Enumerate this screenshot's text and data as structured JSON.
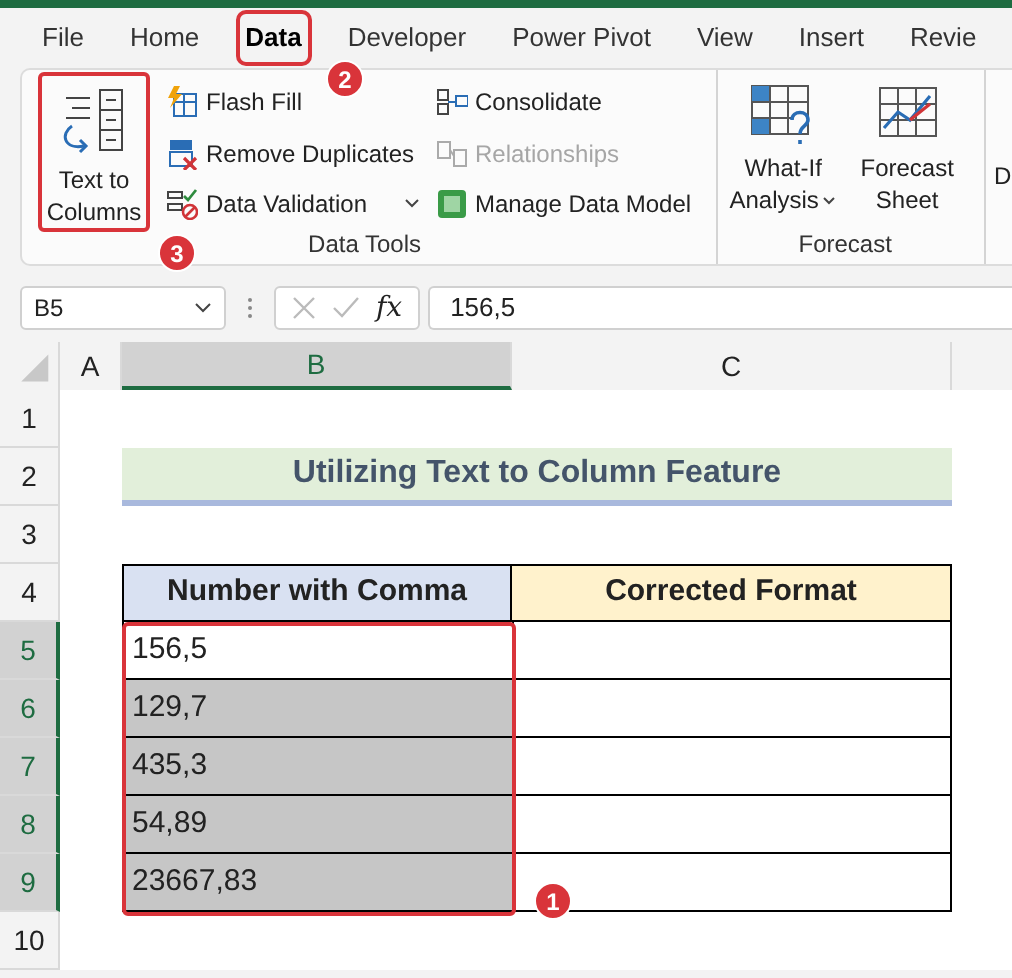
{
  "ribbon_tabs": [
    {
      "label": "File",
      "selected": false,
      "highlighted": false
    },
    {
      "label": "Home",
      "selected": false,
      "highlighted": false
    },
    {
      "label": "Data",
      "selected": true,
      "highlighted": true
    },
    {
      "label": "Developer",
      "selected": false,
      "highlighted": false
    },
    {
      "label": "Power Pivot",
      "selected": false,
      "highlighted": false
    },
    {
      "label": "View",
      "selected": false,
      "highlighted": false
    },
    {
      "label": "Insert",
      "selected": false,
      "highlighted": false
    },
    {
      "label": "Revie",
      "selected": false,
      "highlighted": false
    }
  ],
  "ribbon_groups": [
    {
      "label": "Data Tools",
      "large_button": {
        "label_lines": [
          "Text to",
          "Columns"
        ],
        "highlighted": true
      },
      "small_columns": [
        [
          {
            "label": "Flash Fill",
            "kind": "flashfill",
            "disabled": false
          },
          {
            "label": "Remove Duplicates",
            "kind": "removedup",
            "disabled": false
          },
          {
            "label": "Data Validation",
            "kind": "validation",
            "disabled": false,
            "dropdown": true
          }
        ],
        [
          {
            "label": "Consolidate",
            "kind": "consolidate",
            "disabled": false
          },
          {
            "label": "Relationships",
            "kind": "relationships",
            "disabled": true
          },
          {
            "label": "Manage Data Model",
            "kind": "datamodel",
            "disabled": false
          }
        ]
      ]
    },
    {
      "label": "Forecast",
      "buttons": [
        {
          "label_lines": [
            "What-If",
            "Analysis"
          ],
          "kind": "whatif",
          "dropdown": true
        },
        {
          "label_lines": [
            "Forecast",
            "Sheet"
          ],
          "kind": "forecast",
          "dropdown": false
        }
      ]
    }
  ],
  "ribbon_cut_label": "D",
  "formula_bar": {
    "name_box": "B5",
    "function_label": "fx",
    "value": "156,5"
  },
  "column_headers": [
    {
      "label": "A",
      "selected": false
    },
    {
      "label": "B",
      "selected": true
    },
    {
      "label": "C",
      "selected": false
    }
  ],
  "row_headers": [
    {
      "label": "1",
      "selected": false
    },
    {
      "label": "2",
      "selected": false
    },
    {
      "label": "3",
      "selected": false
    },
    {
      "label": "4",
      "selected": false
    },
    {
      "label": "5",
      "selected": true
    },
    {
      "label": "6",
      "selected": true
    },
    {
      "label": "7",
      "selected": true
    },
    {
      "label": "8",
      "selected": true
    },
    {
      "label": "9",
      "selected": true
    },
    {
      "label": "10",
      "selected": false
    }
  ],
  "sheet_title": "Utilizing Text to Column Feature",
  "table": {
    "columns": [
      "Number with Comma",
      "Corrected Format"
    ],
    "range_highlighted": true,
    "rows": [
      {
        "value": "156,5",
        "active": true
      },
      {
        "value": "129,7",
        "active": false
      },
      {
        "value": "435,3",
        "active": false
      },
      {
        "value": "54,89",
        "active": false
      },
      {
        "value": "23667,83",
        "active": false
      }
    ]
  },
  "step_badges": [
    {
      "label": "1"
    },
    {
      "label": "2"
    },
    {
      "label": "3"
    }
  ]
}
